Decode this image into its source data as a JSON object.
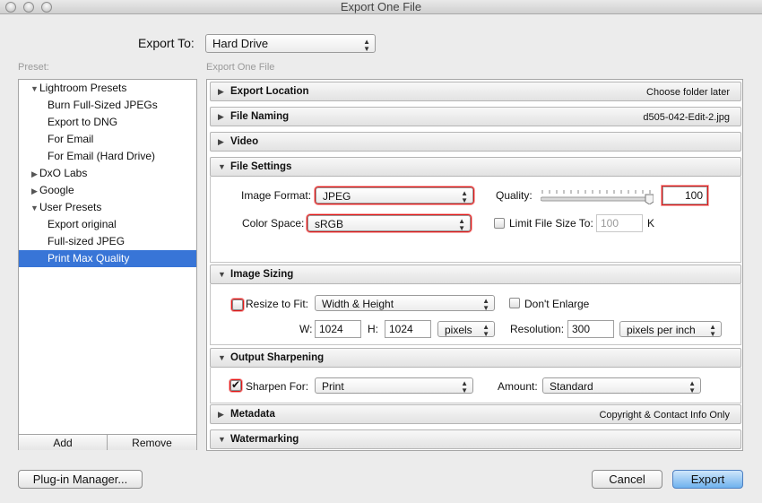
{
  "window": {
    "title": "Export One File"
  },
  "export_to": {
    "label": "Export To:",
    "value": "Hard Drive"
  },
  "preset": {
    "label": "Preset:",
    "items": [
      {
        "label": "Lightroom Presets",
        "expanded": true
      },
      {
        "label": "Burn Full-Sized JPEGs"
      },
      {
        "label": "Export to DNG"
      },
      {
        "label": "For Email"
      },
      {
        "label": "For Email (Hard Drive)"
      },
      {
        "label": "DxO Labs",
        "expanded": false
      },
      {
        "label": "Google",
        "expanded": false
      },
      {
        "label": "User Presets",
        "expanded": true
      },
      {
        "label": "Export original"
      },
      {
        "label": "Full-sized JPEG"
      },
      {
        "label": "Print Max Quality",
        "selected": true
      }
    ],
    "add_label": "Add",
    "remove_label": "Remove"
  },
  "panel_caption": "Export One File",
  "sections": {
    "export_location": {
      "title": "Export Location",
      "summary": "Choose folder later"
    },
    "file_naming": {
      "title": "File Naming",
      "summary": "d505-042-Edit-2.jpg"
    },
    "video": {
      "title": "Video"
    },
    "file_settings": {
      "title": "File Settings",
      "image_format_label": "Image Format:",
      "image_format": "JPEG",
      "quality_label": "Quality:",
      "quality": "100",
      "quality_fraction": 1.0,
      "color_space_label": "Color Space:",
      "color_space": "sRGB",
      "limit_label": "Limit File Size To:",
      "limit_placeholder": "100",
      "limit_unit": "K"
    },
    "image_sizing": {
      "title": "Image Sizing",
      "resize_label": "Resize to Fit:",
      "resize_mode": "Width & Height",
      "dont_enlarge_label": "Don't Enlarge",
      "w_label": "W:",
      "w_value": "1024",
      "h_label": "H:",
      "h_value": "1024",
      "units": "pixels",
      "resolution_label": "Resolution:",
      "resolution": "300",
      "resolution_units": "pixels per inch"
    },
    "output_sharpening": {
      "title": "Output Sharpening",
      "sharpen_label": "Sharpen For:",
      "sharpen_for": "Print",
      "amount_label": "Amount:",
      "amount": "Standard"
    },
    "metadata": {
      "title": "Metadata",
      "summary": "Copyright & Contact Info Only"
    },
    "watermarking": {
      "title": "Watermarking"
    }
  },
  "buttons": {
    "plugin_manager": "Plug-in Manager...",
    "cancel": "Cancel",
    "export": "Export"
  },
  "icons": {
    "collapsed": "disclosure-right-icon",
    "expanded": "disclosure-down-icon",
    "popup": "updown-arrows-icon"
  }
}
